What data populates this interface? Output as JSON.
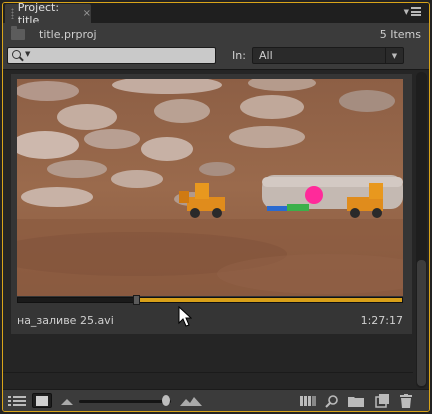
{
  "panel": {
    "tab_title": "Project: title",
    "close_glyph": "×"
  },
  "project": {
    "file_name": "title.prproj",
    "item_count": "5 Items"
  },
  "search": {
    "value": "",
    "placeholder": ""
  },
  "filter": {
    "label": "In:",
    "selected": "All"
  },
  "clip": {
    "name": "на_заливе 25.avi",
    "duration": "1:27:17",
    "playhead_fraction": 0.31
  },
  "scroll": {
    "thumb_fraction": 0.4
  },
  "zoom": {
    "level_fraction": 0.95
  },
  "colors": {
    "accent": "#d8a019",
    "panel_bg": "#2b2b2b",
    "toolbar_bg": "#3b3b3b"
  },
  "icons": {
    "panel_menu": "panel-menu-icon",
    "folder": "folder-icon",
    "search": "search-icon",
    "list_view": "list-view-icon",
    "icon_view": "icon-view-icon",
    "zoom_small": "zoom-small-icon",
    "zoom_large": "zoom-large-icon",
    "automate": "automate-to-sequence-icon",
    "find": "find-icon",
    "new_bin": "new-bin-icon",
    "new_item": "new-item-icon",
    "clear": "trash-icon"
  }
}
